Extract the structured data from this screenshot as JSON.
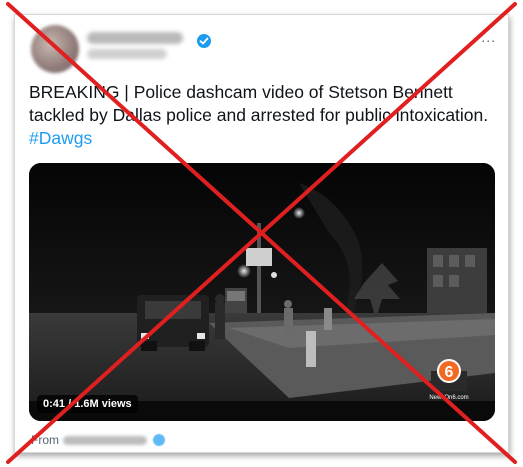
{
  "tweet": {
    "more_label": "...",
    "text_main": "BREAKING | Police dashcam video of Stetson Bennett tackled by Dallas police and arrested for public intoxication. ",
    "hashtag": "#Dawgs"
  },
  "video": {
    "duration": "0:41",
    "views": "1.6M views",
    "badge_separator": " / ",
    "station_logo_number": "6",
    "station_name": "NewsOn6.com"
  },
  "from": {
    "label": "From"
  },
  "colors": {
    "accent": "#1d9bf0",
    "strike": "#e02020"
  },
  "icons": [
    "verified-badge-icon",
    "more-options-icon",
    "strikethrough-x-icon"
  ]
}
